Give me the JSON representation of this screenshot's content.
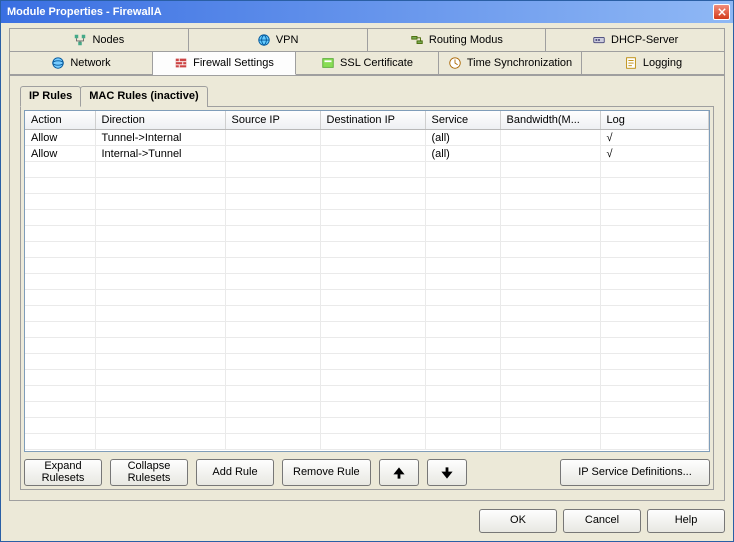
{
  "title": "Module Properties - FirewallA",
  "top_tabs_row1": [
    {
      "name": "nodes",
      "label": "Nodes"
    },
    {
      "name": "vpn",
      "label": "VPN"
    },
    {
      "name": "routing",
      "label": "Routing Modus"
    },
    {
      "name": "dhcp",
      "label": "DHCP-Server"
    }
  ],
  "top_tabs_row2": [
    {
      "name": "network",
      "label": "Network"
    },
    {
      "name": "firewall",
      "label": "Firewall Settings",
      "active": true
    },
    {
      "name": "ssl",
      "label": "SSL Certificate"
    },
    {
      "name": "timesync",
      "label": "Time Synchronization"
    },
    {
      "name": "logging",
      "label": "Logging"
    }
  ],
  "sub_tabs": [
    {
      "name": "iprules",
      "label": "IP Rules",
      "active": true
    },
    {
      "name": "macrules",
      "label": "MAC Rules (inactive)"
    }
  ],
  "columns": [
    {
      "key": "action",
      "label": "Action"
    },
    {
      "key": "direction",
      "label": "Direction"
    },
    {
      "key": "sourceip",
      "label": "Source IP"
    },
    {
      "key": "destip",
      "label": "Destination IP"
    },
    {
      "key": "service",
      "label": "Service"
    },
    {
      "key": "bandwidth",
      "label": "Bandwidth(M..."
    },
    {
      "key": "log",
      "label": "Log"
    }
  ],
  "rows": [
    {
      "action": "Allow",
      "direction": "Tunnel->Internal",
      "sourceip": "",
      "destip": "",
      "service": "(all)",
      "bandwidth": "",
      "log": "√"
    },
    {
      "action": "Allow",
      "direction": "Internal->Tunnel",
      "sourceip": "",
      "destip": "",
      "service": "(all)",
      "bandwidth": "",
      "log": "√"
    }
  ],
  "toolbuttons": {
    "expand": "Expand\nRulesets",
    "collapse": "Collapse\nRulesets",
    "add": "Add Rule",
    "remove": "Remove Rule",
    "ipservice": "IP Service Definitions..."
  },
  "dlg": {
    "ok": "OK",
    "cancel": "Cancel",
    "help": "Help"
  }
}
